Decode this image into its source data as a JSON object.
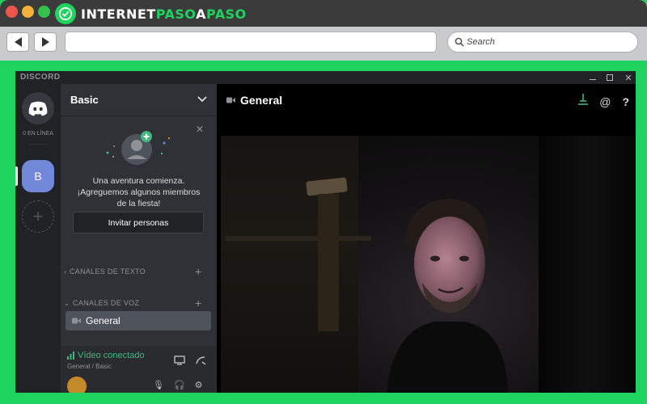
{
  "browser": {
    "brand_part1": "INTERNET",
    "brand_part2": "PASO",
    "brand_part3": "A",
    "brand_part4": "PASO",
    "search_placeholder": "Search"
  },
  "discord": {
    "window_title": "DISCORD",
    "rail": {
      "online_label": "0 EN LÍNEA",
      "server_initial": "B"
    },
    "guild": {
      "name": "Basic"
    },
    "invite_card": {
      "line1": "Una aventura comienza.",
      "line2": "¡Agreguemos algunos miembros",
      "line3": "de la fiesta!",
      "button_label": "Invitar personas"
    },
    "categories": {
      "text": "CANALES DE TEXTO",
      "voice": "CANALES DE VOZ"
    },
    "voice_channel": {
      "name": "General"
    },
    "voice_status": {
      "title": "Vídeo conectado",
      "subtitle": "General / Basic"
    },
    "main": {
      "channel_title": "General"
    }
  },
  "colors": {
    "brand_green": "#1fd35f",
    "discord_blurple": "#7289da",
    "voice_connected_green": "#43b581"
  }
}
